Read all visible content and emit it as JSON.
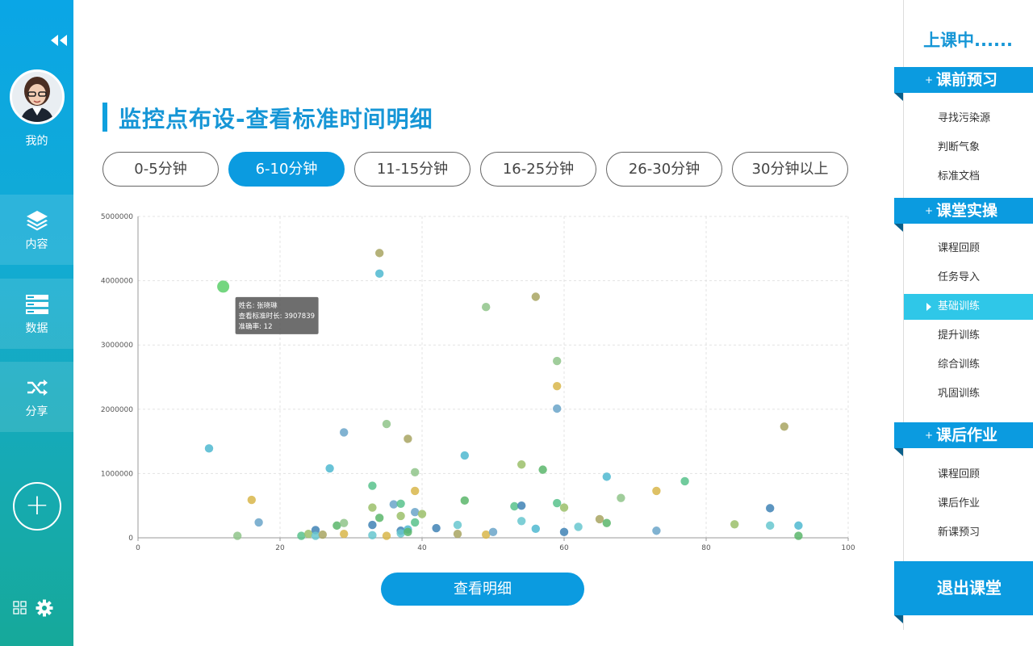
{
  "sidebar": {
    "me_label": "我的",
    "items": [
      {
        "label": "内容",
        "icon": "layers-icon"
      },
      {
        "label": "数据",
        "icon": "database-icon"
      },
      {
        "label": "分享",
        "icon": "shuffle-icon"
      }
    ]
  },
  "main": {
    "title": "监控点布设-查看标准时间明细",
    "tabs": [
      {
        "label": "0-5分钟",
        "active": false
      },
      {
        "label": "6-10分钟",
        "active": true
      },
      {
        "label": "11-15分钟",
        "active": false
      },
      {
        "label": "16-25分钟",
        "active": false
      },
      {
        "label": "26-30分钟",
        "active": false
      },
      {
        "label": "30分钟以上",
        "active": false
      }
    ],
    "detail_button": "查看明细"
  },
  "tooltip": {
    "line1": "姓名: 张晓琳",
    "line2": "查看标准时长: 3907839",
    "line3": "准确率: 12"
  },
  "right": {
    "status": "上课中......",
    "sections": [
      {
        "label": "课前预习",
        "items": [
          "寻找污染源",
          "判断气象",
          "标准文档"
        ]
      },
      {
        "label": "课堂实操",
        "items": [
          "课程回顾",
          "任务导入",
          "基础训练",
          "提升训练",
          "综合训练",
          "巩固训练"
        ]
      },
      {
        "label": "课后作业",
        "items": [
          "课程回顾",
          "课后作业",
          "新课预习"
        ]
      }
    ],
    "active_item": "基础训练",
    "exit": "退出课堂"
  },
  "chart_data": {
    "type": "scatter",
    "xlim": [
      0,
      100
    ],
    "ylim": [
      0,
      5000000
    ],
    "x_ticks": [
      "0",
      "20",
      "40",
      "60",
      "80",
      "100"
    ],
    "y_ticks": [
      "0",
      "1000000",
      "2000000",
      "3000000",
      "4000000",
      "5000000"
    ],
    "grid": true,
    "highlight": {
      "x": 12,
      "y": 3907839
    },
    "points": [
      [
        10,
        1390000
      ],
      [
        12,
        3907839
      ],
      [
        14,
        30000
      ],
      [
        16,
        590000
      ],
      [
        17,
        240000
      ],
      [
        23,
        30000
      ],
      [
        24,
        60000
      ],
      [
        25,
        120000
      ],
      [
        25,
        30000
      ],
      [
        26,
        50000
      ],
      [
        27,
        1080000
      ],
      [
        28,
        190000
      ],
      [
        29,
        230000
      ],
      [
        29,
        60000
      ],
      [
        29,
        1640000
      ],
      [
        33,
        810000
      ],
      [
        33,
        470000
      ],
      [
        33,
        200000
      ],
      [
        33,
        40000
      ],
      [
        34,
        4430000
      ],
      [
        34,
        4110000
      ],
      [
        34,
        310000
      ],
      [
        35,
        1770000
      ],
      [
        35,
        30000
      ],
      [
        36,
        520000
      ],
      [
        37,
        530000
      ],
      [
        37,
        340000
      ],
      [
        37,
        110000
      ],
      [
        37,
        70000
      ],
      [
        38,
        1540000
      ],
      [
        38,
        130000
      ],
      [
        38,
        90000
      ],
      [
        39,
        1020000
      ],
      [
        39,
        730000
      ],
      [
        39,
        400000
      ],
      [
        39,
        240000
      ],
      [
        40,
        370000
      ],
      [
        42,
        150000
      ],
      [
        45,
        200000
      ],
      [
        45,
        60000
      ],
      [
        46,
        1280000
      ],
      [
        46,
        580000
      ],
      [
        49,
        3590000
      ],
      [
        49,
        50000
      ],
      [
        50,
        90000
      ],
      [
        53,
        490000
      ],
      [
        54,
        1140000
      ],
      [
        54,
        500000
      ],
      [
        54,
        260000
      ],
      [
        56,
        3750000
      ],
      [
        56,
        140000
      ],
      [
        57,
        1060000
      ],
      [
        59,
        2750000
      ],
      [
        59,
        2360000
      ],
      [
        59,
        2010000
      ],
      [
        59,
        540000
      ],
      [
        60,
        470000
      ],
      [
        60,
        90000
      ],
      [
        62,
        170000
      ],
      [
        65,
        290000
      ],
      [
        66,
        950000
      ],
      [
        66,
        230000
      ],
      [
        68,
        620000
      ],
      [
        73,
        730000
      ],
      [
        73,
        110000
      ],
      [
        77,
        880000
      ],
      [
        84,
        210000
      ],
      [
        89,
        460000
      ],
      [
        89,
        190000
      ],
      [
        91,
        1730000
      ],
      [
        93,
        190000
      ],
      [
        93,
        30000
      ]
    ]
  },
  "colors": {
    "accent": "#0b9be0",
    "title": "#1696d6",
    "active_item": "#2fc7e8"
  }
}
